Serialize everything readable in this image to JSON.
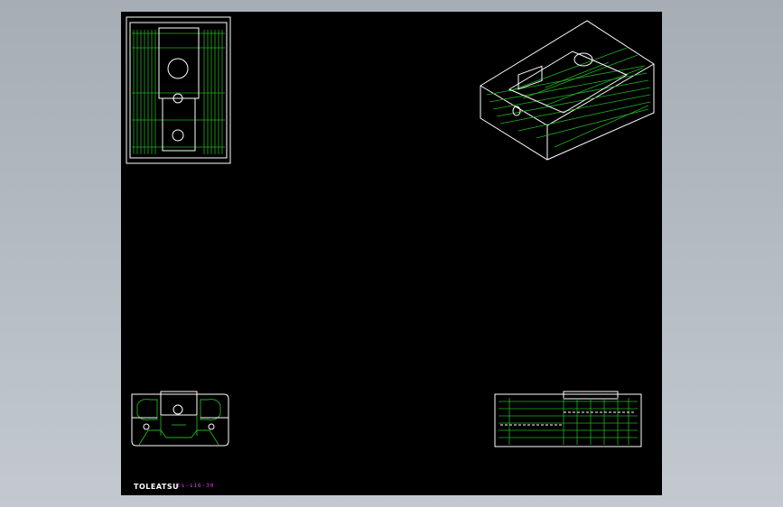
{
  "title_block": {
    "logo_text": "TOLEATSU",
    "part_number": "ts-s16-30"
  },
  "colors": {
    "background": "#b5bcc3",
    "sheet": "#000000",
    "outline": "#ffffff",
    "hidden_lines": "#22b022",
    "part_number": "#e040e0"
  }
}
